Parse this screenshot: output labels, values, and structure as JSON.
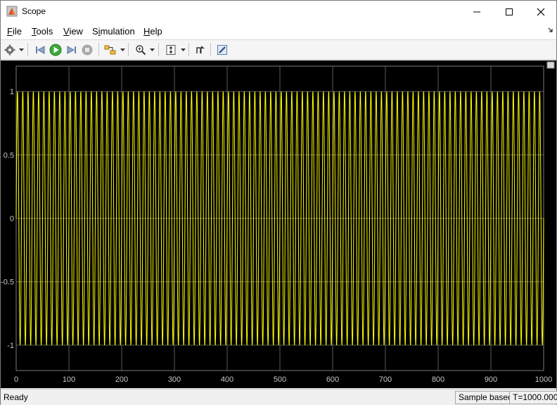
{
  "window": {
    "title": "Scope"
  },
  "menu": {
    "items": [
      "File",
      "Tools",
      "View",
      "Simulation",
      "Help"
    ]
  },
  "toolbar": {
    "buttons": [
      "settings",
      "step-back",
      "run",
      "step-forward",
      "stop",
      "highlight-model",
      "zoom",
      "scale-axes",
      "properties",
      "edit"
    ]
  },
  "colors": {
    "trace": "#ffff00",
    "plot_background": "#000000",
    "grid": "#5a5a5a",
    "tick_text": "#c8c8c8"
  },
  "chart_data": {
    "type": "line",
    "title": "",
    "xlabel": "",
    "ylabel": "",
    "xlim": [
      0,
      1000
    ],
    "ylim": [
      -1.2,
      1.2
    ],
    "x_ticks": [
      "0",
      "100",
      "200",
      "300",
      "400",
      "500",
      "600",
      "700",
      "800",
      "900",
      "1000"
    ],
    "y_ticks": [
      "1",
      "0.5",
      "0",
      "-0.5",
      "-1"
    ],
    "grid": true,
    "series": [
      {
        "function": "sin",
        "amplitude": 1,
        "cycles": 100,
        "x_start": 0,
        "x_end": 1000
      }
    ]
  },
  "status": {
    "left": "Ready",
    "mode": "Sample based",
    "time": "T=1000.000"
  }
}
